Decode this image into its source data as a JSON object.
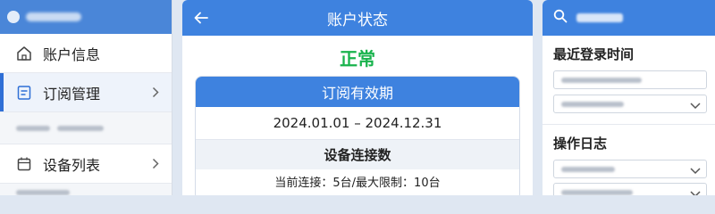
{
  "left_panel": {
    "menu": [
      {
        "label": "账户信息",
        "icon": "home-icon",
        "active": false
      },
      {
        "label": "订阅管理",
        "icon": "document-icon",
        "active": true
      },
      {
        "label": "设备列表",
        "icon": "calendar-icon",
        "active": false
      }
    ]
  },
  "center_panel": {
    "title": "账户状态",
    "status": "正常",
    "subscription": {
      "header": "订阅有效期",
      "range": "2024.01.01 – 2024.12.31"
    },
    "devices": {
      "header": "设备连接数",
      "detail": "当前连接：5台/最大限制：10台"
    }
  },
  "right_panel": {
    "sections": [
      {
        "label": "最近登录时间"
      },
      {
        "label": "操作日志"
      }
    ]
  },
  "colors": {
    "accent": "#3e82df",
    "status_ok": "#19b34d"
  }
}
